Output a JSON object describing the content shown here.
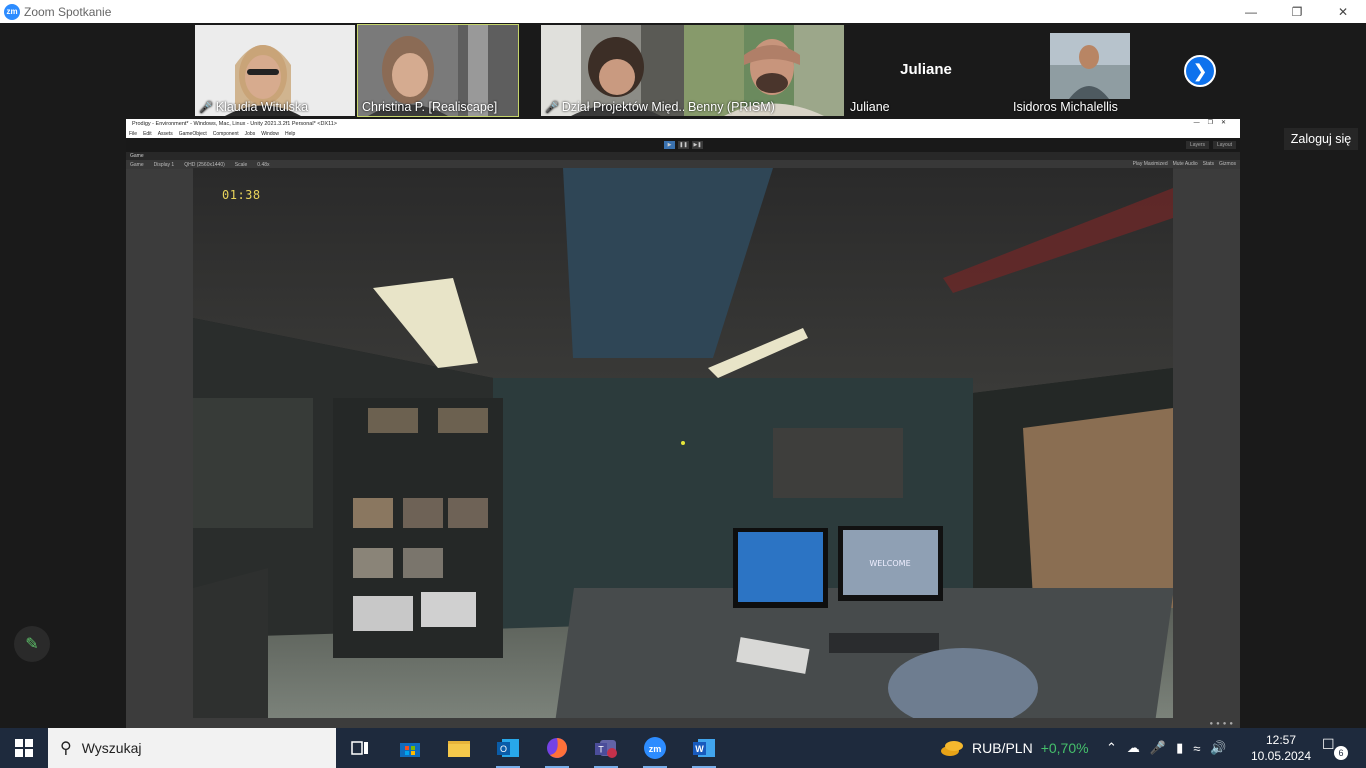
{
  "window": {
    "title": "Zoom Spotkanie",
    "logo": "zm"
  },
  "participants": [
    {
      "name": "Klaudia Witulska",
      "muted": true
    },
    {
      "name": "Christina P. [Realiscape]",
      "muted": false,
      "active": true
    },
    {
      "name": "Dział Projektów Międ...",
      "muted": true
    },
    {
      "name": "Benny (PRISM)",
      "muted": false
    },
    {
      "name": "Juliane",
      "muted": false,
      "no_video": true,
      "display_name": "Juliane"
    },
    {
      "name": "Isidoros Michalellis",
      "muted": false
    }
  ],
  "sign_in": "Zaloguj się",
  "unity": {
    "title": "Prodigy - Environment* - Windows, Mac, Linux - Unity 2021.3.2f1 Personal* <DX11>",
    "menu": [
      "File",
      "Edit",
      "Assets",
      "GameObject",
      "Component",
      "Jobs",
      "Window",
      "Help"
    ],
    "toolbar_right": [
      "Layers",
      "Layout"
    ],
    "tab": "Game",
    "gamebar": [
      "Game",
      "Display 1",
      "QHD (2560x1440)",
      "Scale",
      "0.48x"
    ],
    "gamebar_right": [
      "Play Maximized",
      "Mute Audio",
      "Stats",
      "Gizmos"
    ],
    "timer": "01:38",
    "monitor_text": "WELCOME"
  },
  "taskbar": {
    "search_placeholder": "Wyszukaj",
    "ticker_pair": "RUB/PLN",
    "ticker_change": "+0,70%",
    "time": "12:57",
    "date": "10.05.2024",
    "notifications": "6"
  }
}
